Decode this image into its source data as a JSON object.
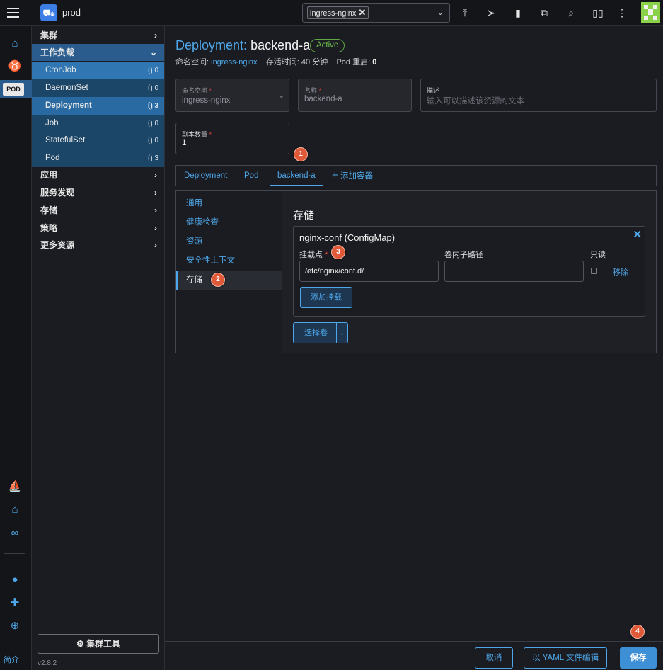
{
  "topbar": {
    "cluster": "prod",
    "namespace_tag": "ingress-nginx",
    "tool_icons": [
      "upload-icon",
      "shell-icon",
      "file-icon",
      "copy-icon",
      "search-icon",
      "book-icon",
      "more-icon"
    ]
  },
  "rail": {
    "pod_badge": "POD",
    "bottom_link": "简介"
  },
  "sidemenu": {
    "groups": [
      {
        "label": "集群",
        "chev": "›"
      },
      {
        "label": "工作负载",
        "chev": "⌄"
      },
      {
        "label": "应用",
        "chev": "›"
      },
      {
        "label": "服务发现",
        "chev": "›"
      },
      {
        "label": "存储",
        "chev": "›"
      },
      {
        "label": "策略",
        "chev": "›"
      },
      {
        "label": "更多资源",
        "chev": "›"
      }
    ],
    "workloads": [
      {
        "label": "CronJob",
        "count": "0"
      },
      {
        "label": "DaemonSet",
        "count": "0"
      },
      {
        "label": "Deployment",
        "count": "3"
      },
      {
        "label": "Job",
        "count": "0"
      },
      {
        "label": "StatefulSet",
        "count": "0"
      },
      {
        "label": "Pod",
        "count": "3"
      }
    ],
    "cluster_tools": "⚙ 集群工具",
    "version": "v2.8.2"
  },
  "main": {
    "kind": "Deployment:",
    "name": "backend-a",
    "status": "Active",
    "meta": {
      "ns_label": "命名空间:",
      "ns_value": "ingress-nginx",
      "age_label": "存活时间:",
      "age_value": "40 分钟",
      "restarts_label": "Pod 重启:",
      "restarts_value": "0"
    },
    "fields": {
      "namespace_label": "命名空间",
      "namespace_value": "ingress-nginx",
      "name_label": "名称",
      "name_value": "backend-a",
      "desc_label": "描述",
      "desc_placeholder": "输入可以描述该资源的文本",
      "replicas_label": "副本数量",
      "replicas_value": "1"
    },
    "tabs": [
      "Deployment",
      "Pod",
      "backend-a",
      "添加容器"
    ],
    "vtabs": [
      "通用",
      "健康检查",
      "资源",
      "安全性上下文",
      "存储"
    ],
    "storage": {
      "title": "存储",
      "volume_title": "nginx-conf (ConfigMap)",
      "mount_label": "挂载点",
      "subpath_label": "卷内子路径",
      "readonly_label": "只读",
      "mount_value": "/etc/nginx/conf.d/",
      "subpath_value": "",
      "remove": "移除",
      "add_mount": "添加挂载",
      "choose_volume": "选择卷"
    },
    "footer": {
      "cancel": "取消",
      "yaml": "以 YAML 文件编辑",
      "save": "保存"
    }
  },
  "steps": [
    "1",
    "2",
    "3",
    "4"
  ]
}
